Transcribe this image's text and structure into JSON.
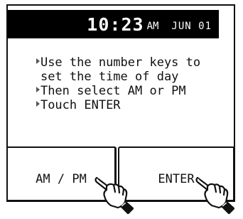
{
  "header": {
    "time": "10:23",
    "meridiem": "AM",
    "date": "JUN 01"
  },
  "instructions": [
    {
      "text": "Use the number keys to",
      "bullet": true
    },
    {
      "text": "set the time of day",
      "bullet": false
    },
    {
      "text": "Then select AM or PM",
      "bullet": true
    },
    {
      "text": "Touch ENTER",
      "bullet": true
    }
  ],
  "buttons": {
    "ampm_label": "AM / PM",
    "enter_label": "ENTER"
  },
  "icons": {
    "bullet": "triangle-bullet-icon",
    "pointer": "pointing-hand-icon"
  },
  "colors": {
    "header_bg": "#000000",
    "header_text": "#ffffff",
    "text": "#111111",
    "background": "#ffffff"
  }
}
